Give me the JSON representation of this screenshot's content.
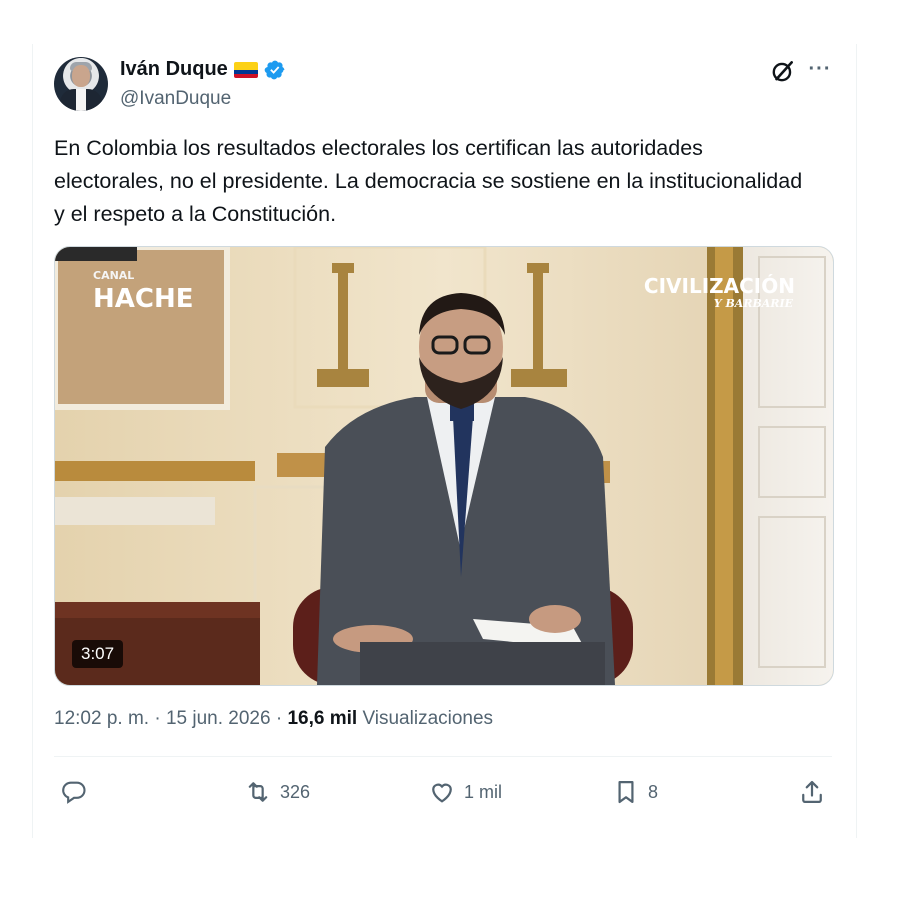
{
  "author": {
    "name": "Iván Duque",
    "handle": "@IvanDuque",
    "flag_colors": [
      "#fcd116",
      "#003893",
      "#ce1126"
    ],
    "verified_color": "#1d9bf0"
  },
  "tweet": {
    "text": "En Colombia los resultados electorales los certifican las autoridades electorales, no el presidente. La democracia se sostiene en la institucionalidad y el respeto a la Constitución."
  },
  "video": {
    "duration": "3:07",
    "overlay_left_small": "CANAL",
    "overlay_left_big": "HACHE",
    "overlay_right_big": "CIVILIZACIÓN",
    "overlay_right_small": "Y BARBARIE"
  },
  "meta": {
    "time": "12:02 p. m.",
    "separator": "·",
    "date": "15 jun. 2026",
    "views_count": "16,6 mil",
    "views_label": "Visualizaciones"
  },
  "actions": {
    "reply_icon": "reply-icon",
    "retweet_count": "326",
    "like_count": "1 mil",
    "bookmark_count": "8",
    "share_icon": "share-icon"
  }
}
